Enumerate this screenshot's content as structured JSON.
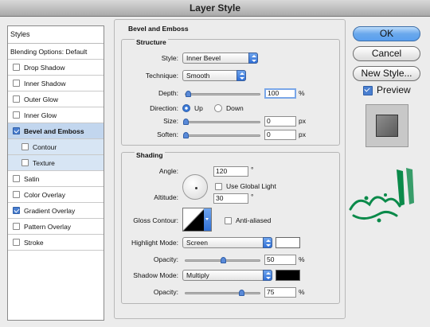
{
  "window": {
    "title": "Layer Style"
  },
  "styles_panel": {
    "header": "Styles",
    "items": [
      {
        "label": "Blending Options: Default",
        "checkbox": false,
        "checked": false,
        "selected": false,
        "sub": false
      },
      {
        "label": "Drop Shadow",
        "checkbox": true,
        "checked": false,
        "selected": false,
        "sub": false
      },
      {
        "label": "Inner Shadow",
        "checkbox": true,
        "checked": false,
        "selected": false,
        "sub": false
      },
      {
        "label": "Outer Glow",
        "checkbox": true,
        "checked": false,
        "selected": false,
        "sub": false
      },
      {
        "label": "Inner Glow",
        "checkbox": true,
        "checked": false,
        "selected": false,
        "sub": false
      },
      {
        "label": "Bevel and Emboss",
        "checkbox": true,
        "checked": true,
        "selected": true,
        "sub": false
      },
      {
        "label": "Contour",
        "checkbox": true,
        "checked": false,
        "selected": false,
        "sub": true
      },
      {
        "label": "Texture",
        "checkbox": true,
        "checked": false,
        "selected": false,
        "sub": true
      },
      {
        "label": "Satin",
        "checkbox": true,
        "checked": false,
        "selected": false,
        "sub": false
      },
      {
        "label": "Color Overlay",
        "checkbox": true,
        "checked": false,
        "selected": false,
        "sub": false
      },
      {
        "label": "Gradient Overlay",
        "checkbox": true,
        "checked": true,
        "selected": false,
        "sub": false
      },
      {
        "label": "Pattern Overlay",
        "checkbox": true,
        "checked": false,
        "selected": false,
        "sub": false
      },
      {
        "label": "Stroke",
        "checkbox": true,
        "checked": false,
        "selected": false,
        "sub": false
      }
    ]
  },
  "bevel": {
    "title": "Bevel and Emboss",
    "structure": {
      "title": "Structure",
      "style_label": "Style:",
      "style_value": "Inner Bevel",
      "technique_label": "Technique:",
      "technique_value": "Smooth",
      "depth_label": "Depth:",
      "depth_value": "100",
      "depth_unit": "%",
      "depth_level": 0.03,
      "direction_label": "Direction:",
      "direction_up": "Up",
      "direction_down": "Down",
      "direction_selected": "Up",
      "size_label": "Size:",
      "size_value": "0",
      "size_unit": "px",
      "size_level": 0,
      "soften_label": "Soften:",
      "soften_value": "0",
      "soften_unit": "px",
      "soften_level": 0
    },
    "shading": {
      "title": "Shading",
      "angle_label": "Angle:",
      "angle_value": "120",
      "angle_unit": "°",
      "global_light_label": "Use Global Light",
      "global_light_checked": false,
      "altitude_label": "Altitude:",
      "altitude_value": "30",
      "altitude_unit": "°",
      "gloss_label": "Gloss Contour:",
      "anti_aliased_label": "Anti-aliased",
      "anti_aliased_checked": false,
      "highlight_mode_label": "Highlight Mode:",
      "highlight_mode_value": "Screen",
      "highlight_color": "#ffffff",
      "highlight_opacity_label": "Opacity:",
      "highlight_opacity_value": "50",
      "highlight_opacity_unit": "%",
      "highlight_opacity_level": 0.5,
      "shadow_mode_label": "Shadow Mode:",
      "shadow_mode_value": "Multiply",
      "shadow_color": "#000000",
      "shadow_opacity_label": "Opacity:",
      "shadow_opacity_value": "75",
      "shadow_opacity_unit": "%",
      "shadow_opacity_level": 0.75
    }
  },
  "buttons": {
    "ok": "OK",
    "cancel": "Cancel",
    "new_style": "New Style...",
    "preview": "Preview",
    "preview_checked": true
  },
  "colors": {
    "accent": "#4a7fd0",
    "logo_green": "#0b8a4a"
  }
}
